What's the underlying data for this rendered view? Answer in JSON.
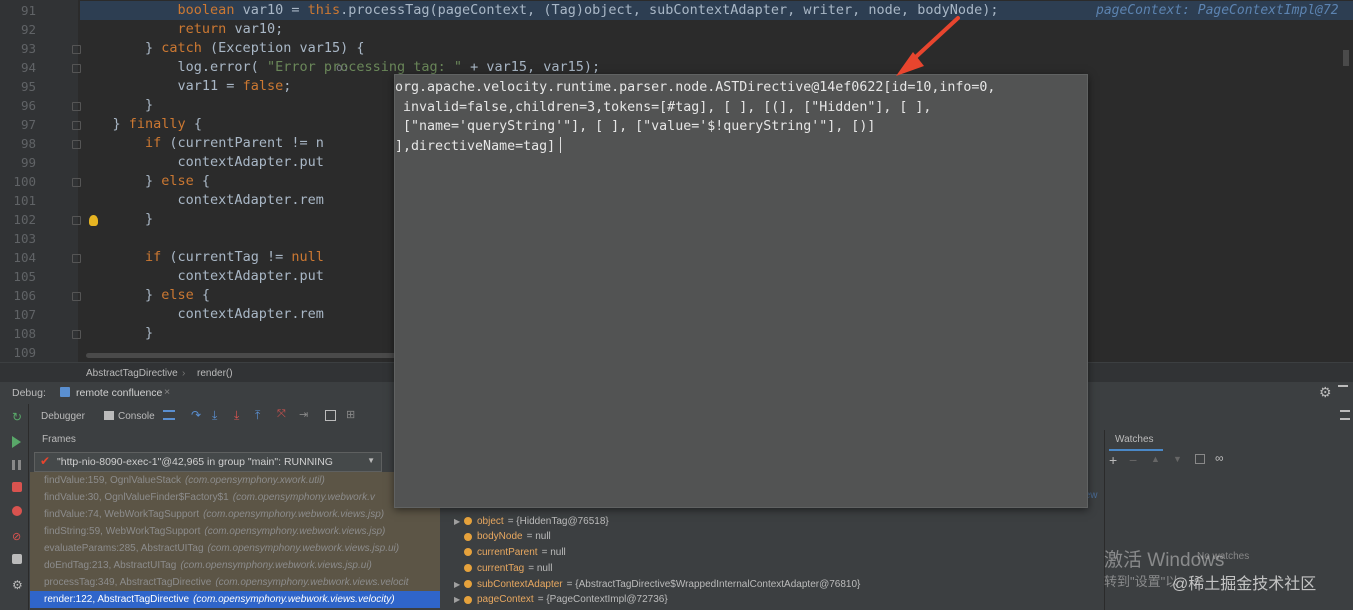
{
  "editor": {
    "lines": [
      {
        "n": "91",
        "text": "            boolean var10 = this.processTag(pageContext, (Tag)object, subContextAdapter, writer, node, bodyNode);",
        "inline": "pageContext: PageContextImpl@72"
      },
      {
        "n": "92",
        "text": "            return var10;"
      },
      {
        "n": "93",
        "text": "        } catch (Exception var15) {"
      },
      {
        "n": "94",
        "text": "            log.error( \"Error processing tag: \" + var15, var15);",
        "hint": "o:"
      },
      {
        "n": "95",
        "text": "            var11 = false;"
      },
      {
        "n": "96",
        "text": "        }"
      },
      {
        "n": "97",
        "text": "    } finally {"
      },
      {
        "n": "98",
        "text": "        if (currentParent != n"
      },
      {
        "n": "99",
        "text": "            contextAdapter.put"
      },
      {
        "n": "100",
        "text": "        } else {"
      },
      {
        "n": "101",
        "text": "            contextAdapter.rem"
      },
      {
        "n": "102",
        "text": "        }"
      },
      {
        "n": "103",
        "text": ""
      },
      {
        "n": "104",
        "text": "        if (currentTag != null"
      },
      {
        "n": "105",
        "text": "            contextAdapter.put"
      },
      {
        "n": "106",
        "text": "        } else {"
      },
      {
        "n": "107",
        "text": "            contextAdapter.rem"
      },
      {
        "n": "108",
        "text": "        }"
      },
      {
        "n": "109",
        "text": ""
      }
    ]
  },
  "breadcrumb": {
    "class": "AbstractTagDirective",
    "method": "render()"
  },
  "popup": {
    "lines": [
      "org.apache.velocity.runtime.parser.node.ASTDirective@14ef0622[id=10,info=0,",
      " invalid=false,children=3,tokens=[#tag], [ ], [(], [\"Hidden\"], [ ],",
      " [\"name='queryString'\"], [ ], [\"value='$!queryString'\"], [)]",
      "],directiveName=tag]"
    ]
  },
  "debug": {
    "label": "Debug:",
    "session": "remote confluence",
    "tab_debugger": "Debugger",
    "tab_console": "Console",
    "frames_label": "Frames",
    "watches_label": "Watches",
    "thread": "\"http-nio-8090-exec-1\"@42,965 in group \"main\": RUNNING",
    "frames": [
      {
        "m": "findValue:159, OgnlValueStack",
        "p": "(com.opensymphony.xwork.util)"
      },
      {
        "m": "findValue:30, OgnlValueFinder$Factory$1",
        "p": "(com.opensymphony.webwork.v"
      },
      {
        "m": "findValue:74, WebWorkTagSupport",
        "p": "(com.opensymphony.webwork.views.jsp)"
      },
      {
        "m": "findString:59, WebWorkTagSupport",
        "p": "(com.opensymphony.webwork.views.jsp)"
      },
      {
        "m": "evaluateParams:285, AbstractUITag",
        "p": "(com.opensymphony.webwork.views.jsp.ui)"
      },
      {
        "m": "doEndTag:213, AbstractUITag",
        "p": "(com.opensymphony.webwork.views.jsp.ui)"
      },
      {
        "m": "processTag:349, AbstractTagDirective",
        "p": "(com.opensymphony.webwork.views.velocit"
      },
      {
        "m": "render:122, AbstractTagDirective",
        "p": "(com.opensymphony.webwork.views.velocity)"
      }
    ],
    "variables": [
      {
        "name": "node",
        "val": "= {ASTDirective@14ef0622} \"org.apache.velocity.runtime.parser.node.ASTDirective@14ef0622[id=10,info=0,invalid=fal...",
        "link": "View",
        "expand": true
      },
      {
        "name": "object",
        "val": "= {HiddenTag@76518}",
        "expand": true
      },
      {
        "name": "bodyNode",
        "val": "= null",
        "expand": false
      },
      {
        "name": "currentParent",
        "val": "= null",
        "expand": false
      },
      {
        "name": "currentTag",
        "val": "= null",
        "expand": false
      },
      {
        "name": "subContextAdapter",
        "val": "= {AbstractTagDirective$WrappedInternalContextAdapter@76810}",
        "expand": true
      },
      {
        "name": "pageContext",
        "val": "= {PageContextImpl@72736}",
        "expand": true
      }
    ],
    "watches_empty": "No watches"
  },
  "watermark": {
    "line1": "激活 Windows",
    "line2": "转到\"设置\"以",
    "line3": "@稀土掘金技术社区"
  },
  "colors": {
    "arrow": "#e8452e",
    "selected": "#2f65ca"
  }
}
